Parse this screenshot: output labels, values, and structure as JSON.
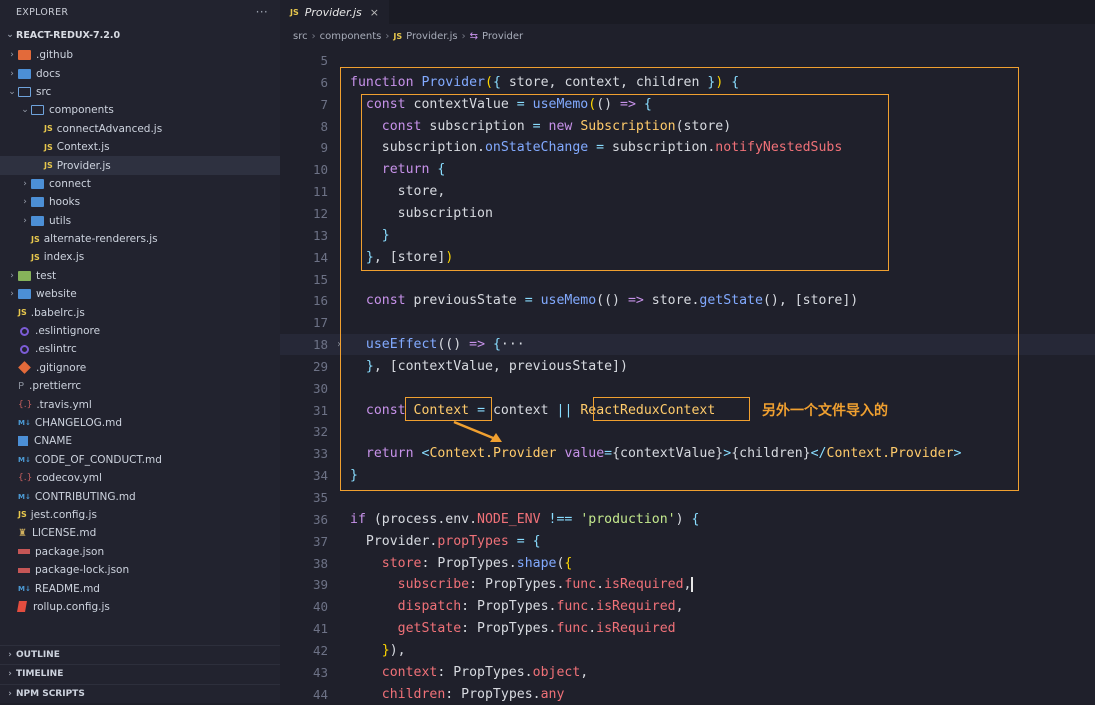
{
  "explorer": {
    "title": "EXPLORER",
    "more": "···",
    "project": "REACT-REDUX-7.2.0",
    "items": [
      {
        "label": ".github",
        "indent": 0,
        "chev": "›",
        "icon": "folder-github"
      },
      {
        "label": "docs",
        "indent": 0,
        "chev": "›",
        "icon": "folder"
      },
      {
        "label": "src",
        "indent": 0,
        "chev": "⌄",
        "icon": "folder-open"
      },
      {
        "label": "components",
        "indent": 1,
        "chev": "⌄",
        "icon": "folder-open"
      },
      {
        "label": "connectAdvanced.js",
        "indent": 2,
        "chev": "",
        "icon": "js"
      },
      {
        "label": "Context.js",
        "indent": 2,
        "chev": "",
        "icon": "js"
      },
      {
        "label": "Provider.js",
        "indent": 2,
        "chev": "",
        "icon": "js",
        "active": true
      },
      {
        "label": "connect",
        "indent": 1,
        "chev": "›",
        "icon": "folder"
      },
      {
        "label": "hooks",
        "indent": 1,
        "chev": "›",
        "icon": "folder"
      },
      {
        "label": "utils",
        "indent": 1,
        "chev": "›",
        "icon": "folder"
      },
      {
        "label": "alternate-renderers.js",
        "indent": 1,
        "chev": "",
        "icon": "js"
      },
      {
        "label": "index.js",
        "indent": 1,
        "chev": "",
        "icon": "js"
      },
      {
        "label": "test",
        "indent": 0,
        "chev": "›",
        "icon": "folder-test"
      },
      {
        "label": "website",
        "indent": 0,
        "chev": "›",
        "icon": "folder"
      },
      {
        "label": ".babelrc.js",
        "indent": 0,
        "chev": "",
        "icon": "js"
      },
      {
        "label": ".eslintignore",
        "indent": 0,
        "chev": "",
        "icon": "eslint"
      },
      {
        "label": ".eslintrc",
        "indent": 0,
        "chev": "",
        "icon": "eslint"
      },
      {
        "label": ".gitignore",
        "indent": 0,
        "chev": "",
        "icon": "git"
      },
      {
        "label": ".prettierrc",
        "indent": 0,
        "chev": "",
        "icon": "prettier"
      },
      {
        "label": ".travis.yml",
        "indent": 0,
        "chev": "",
        "icon": "yml"
      },
      {
        "label": "CHANGELOG.md",
        "indent": 0,
        "chev": "",
        "icon": "md"
      },
      {
        "label": "CNAME",
        "indent": 0,
        "chev": "",
        "icon": "cname"
      },
      {
        "label": "CODE_OF_CONDUCT.md",
        "indent": 0,
        "chev": "",
        "icon": "md"
      },
      {
        "label": "codecov.yml",
        "indent": 0,
        "chev": "",
        "icon": "yml"
      },
      {
        "label": "CONTRIBUTING.md",
        "indent": 0,
        "chev": "",
        "icon": "md"
      },
      {
        "label": "jest.config.js",
        "indent": 0,
        "chev": "",
        "icon": "js"
      },
      {
        "label": "LICENSE.md",
        "indent": 0,
        "chev": "",
        "icon": "license"
      },
      {
        "label": "package.json",
        "indent": 0,
        "chev": "",
        "icon": "npm"
      },
      {
        "label": "package-lock.json",
        "indent": 0,
        "chev": "",
        "icon": "npm"
      },
      {
        "label": "README.md",
        "indent": 0,
        "chev": "",
        "icon": "md"
      },
      {
        "label": "rollup.config.js",
        "indent": 0,
        "chev": "",
        "icon": "rollup"
      }
    ],
    "footer": [
      "OUTLINE",
      "TIMELINE",
      "NPM SCRIPTS"
    ]
  },
  "tab": {
    "icon": "JS",
    "label": "Provider.js",
    "close": "×"
  },
  "breadcrumb": [
    "src",
    "components",
    "Provider.js",
    "Provider"
  ],
  "breadcrumb_icon": "JS",
  "annotation": "另外一个文件导入的",
  "code_lines": [
    {
      "n": "5",
      "html": ""
    },
    {
      "n": "6",
      "html": "<span class='kw'>function</span> <span class='fn'>Provider</span><span class='br1'>(</span><span class='pu'>{</span> store, context, children <span class='pu'>}</span><span class='br1'>)</span> <span class='pu'>{</span>"
    },
    {
      "n": "7",
      "html": "  <span class='kw'>const</span> contextValue <span class='pu'>=</span> <span class='fn'>useMemo</span><span class='br1'>(</span>() <span class='kw'>=></span> <span class='pu'>{</span>"
    },
    {
      "n": "8",
      "html": "    <span class='kw'>const</span> subscription <span class='pu'>=</span> <span class='kw'>new</span> <span class='cl'>Subscription</span>(store)"
    },
    {
      "n": "9",
      "html": "    subscription.<span class='fn'>onStateChange</span> <span class='pu'>=</span> subscription.<span class='pr'>notifyNestedSubs</span>"
    },
    {
      "n": "10",
      "html": "    <span class='kw'>return</span> <span class='pu'>{</span>"
    },
    {
      "n": "11",
      "html": "      store,"
    },
    {
      "n": "12",
      "html": "      subscription"
    },
    {
      "n": "13",
      "html": "    <span class='pu'>}</span>"
    },
    {
      "n": "14",
      "html": "  <span class='pu'>}</span>, [store]<span class='br1'>)</span>"
    },
    {
      "n": "15",
      "html": ""
    },
    {
      "n": "16",
      "html": "  <span class='kw'>const</span> previousState <span class='pu'>=</span> <span class='fn'>useMemo</span>(() <span class='kw'>=></span> store.<span class='fn'>getState</span>(), [store])"
    },
    {
      "n": "17",
      "html": ""
    },
    {
      "n": "18",
      "html": "  <span class='fn'>useEffect</span>(() <span class='kw'>=></span> <span class='pu'>{</span><span class='pl'>···</span>",
      "hl": true,
      "fold": "›"
    },
    {
      "n": "29",
      "html": "  <span class='pu'>}</span>, [contextValue, previousState])"
    },
    {
      "n": "30",
      "html": ""
    },
    {
      "n": "31",
      "html": "  <span class='kw'>const</span> <span class='cl'>Context</span> <span class='pu'>=</span> context <span class='pu'>||</span> <span class='cl'>ReactReduxContext</span>"
    },
    {
      "n": "32",
      "html": ""
    },
    {
      "n": "33",
      "html": "  <span class='kw'>return</span> <span class='pu'>&lt;</span><span class='cl'>Context.Provider</span> <span class='kw'>value</span><span class='pu'>=</span>{contextValue}<span class='pu'>&gt;</span>{children}<span class='pu'>&lt;/</span><span class='cl'>Context.Provider</span><span class='pu'>&gt;</span>"
    },
    {
      "n": "34",
      "html": "<span class='pu'>}</span>"
    },
    {
      "n": "35",
      "html": ""
    },
    {
      "n": "36",
      "html": "<span class='kw'>if</span> (process.env.<span class='pr'>NODE_ENV</span> <span class='pu'>!==</span> <span class='st'>'production'</span>) <span class='pu'>{</span>"
    },
    {
      "n": "37",
      "html": "  Provider.<span class='pr'>propTypes</span> <span class='pu'>=</span> <span class='pu'>{</span>"
    },
    {
      "n": "38",
      "html": "    <span class='pr'>store</span>: PropTypes.<span class='fn'>shape</span>(<span class='br1'>{</span>"
    },
    {
      "n": "39",
      "html": "      <span class='pr'>subscribe</span>: PropTypes.<span class='pr'>func</span>.<span class='pr'>isRequired</span>,<span class='cursor'></span>"
    },
    {
      "n": "40",
      "html": "      <span class='pr'>dispatch</span>: PropTypes.<span class='pr'>func</span>.<span class='pr'>isRequired</span>,"
    },
    {
      "n": "41",
      "html": "      <span class='pr'>getState</span>: PropTypes.<span class='pr'>func</span>.<span class='pr'>isRequired</span>"
    },
    {
      "n": "42",
      "html": "    <span class='br1'>}</span>),"
    },
    {
      "n": "43",
      "html": "    <span class='pr'>context</span>: PropTypes.<span class='pr'>object</span>,"
    },
    {
      "n": "44",
      "html": "    <span class='pr'>children</span>: PropTypes.<span class='pr'>any</span>"
    }
  ]
}
